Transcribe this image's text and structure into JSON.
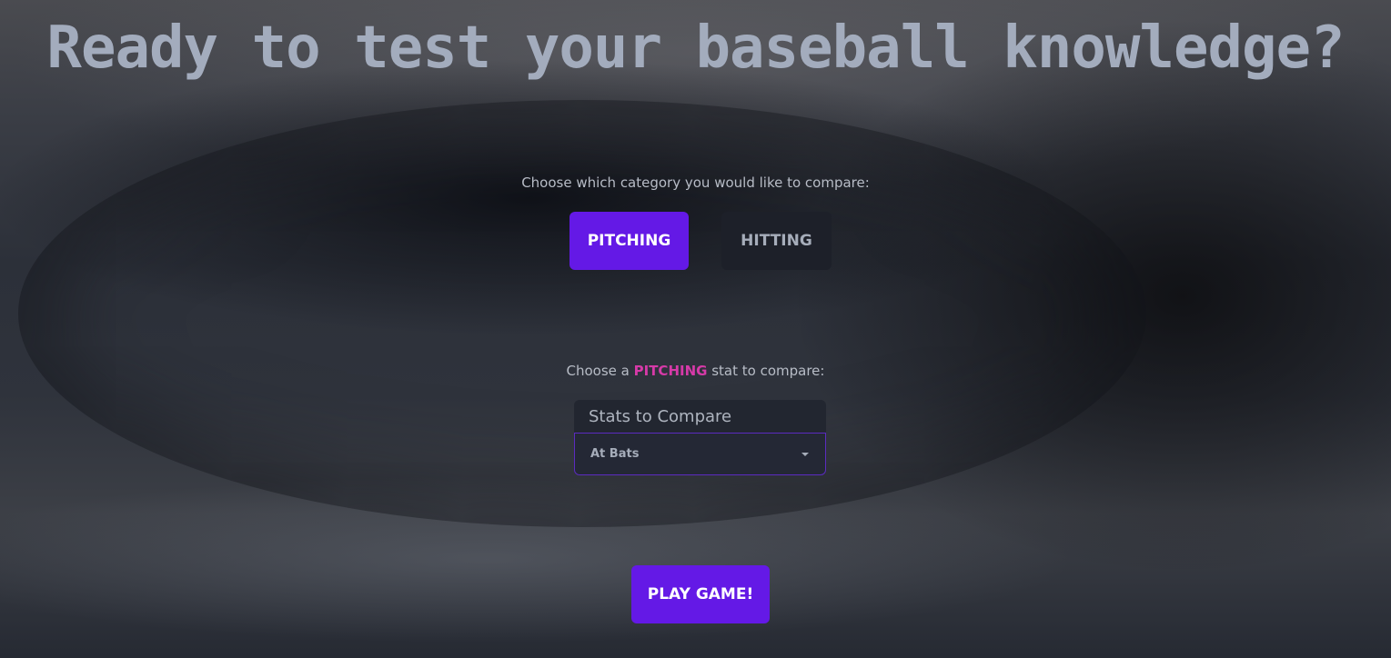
{
  "page": {
    "title": "Ready to test your baseball knowledge?"
  },
  "category": {
    "prompt": "Choose which category you would like to compare:",
    "options": [
      {
        "label": "PITCHING",
        "selected": true
      },
      {
        "label": "HITTING",
        "selected": false
      }
    ]
  },
  "stat": {
    "prompt_before": "Choose a ",
    "prompt_highlight": "PITCHING",
    "prompt_after": " stat to compare:",
    "select_label": "Stats to Compare",
    "selected_value": "At Bats"
  },
  "actions": {
    "play_label": "PLAY GAME!"
  },
  "colors": {
    "accent": "#6419e6",
    "highlight": "#d63aa8",
    "dark_button": "#1d2029",
    "title": "#a3acbd"
  },
  "icons": {
    "select_caret": "caret-down-icon"
  }
}
